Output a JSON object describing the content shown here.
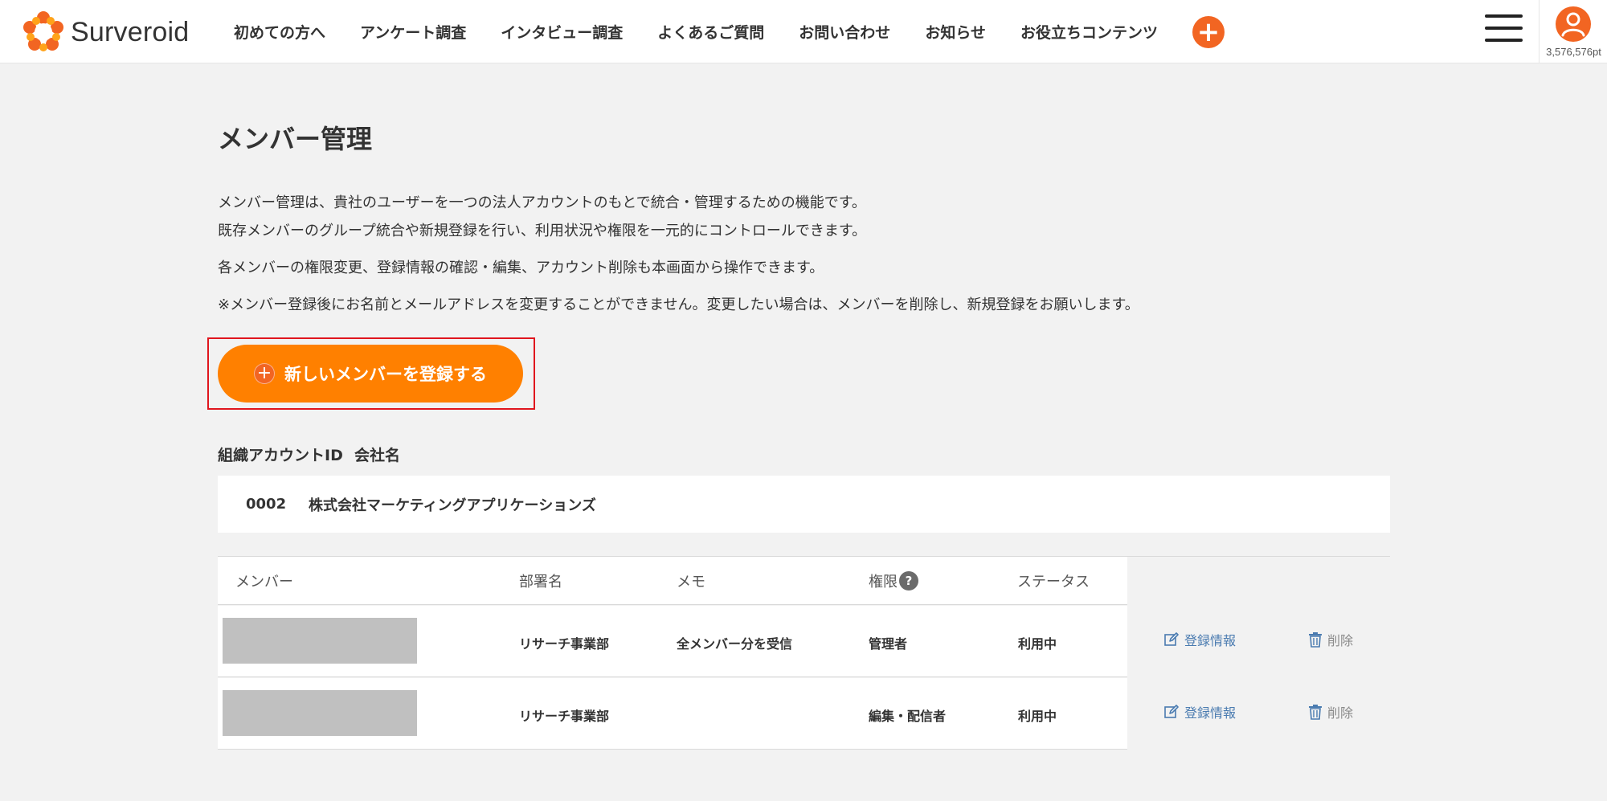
{
  "header": {
    "logo_text": "Surveroid",
    "nav": [
      "初めての方へ",
      "アンケート調査",
      "インタビュー調査",
      "よくあるご質問",
      "お問い合わせ",
      "お知らせ",
      "お役立ちコンテンツ"
    ],
    "plus_symbol": "+",
    "points": "3,576,576pt"
  },
  "page": {
    "title": "メンバー管理",
    "desc1": "メンバー管理は、貴社のユーザーを一つの法人アカウントのもとで統合・管理するための機能です。",
    "desc2": "既存メンバーのグループ統合や新規登録を行い、利用状況や権限を一元的にコントロールできます。",
    "desc3": "各メンバーの権限変更、登録情報の確認・編集、アカウント削除も本画面から操作できます。",
    "desc4": "※メンバー登録後にお名前とメールアドレスを変更することができません。変更したい場合は、メンバーを削除し、新規登録をお願いします。",
    "register_button": "新しいメンバーを登録する",
    "register_plus": "+"
  },
  "org": {
    "id_label": "組織アカウントID",
    "name_label": "会社名",
    "id": "0002",
    "name": "株式会社マーケティングアプリケーションズ"
  },
  "table": {
    "headers": {
      "member": "メンバー",
      "dept": "部署名",
      "memo": "メモ",
      "role": "権限",
      "status": "ステータス",
      "help": "?"
    },
    "rows": [
      {
        "dept": "リサーチ事業部",
        "memo": "全メンバー分を受信",
        "role": "管理者",
        "status": "利用中",
        "edit": "登録情報",
        "delete": "削除"
      },
      {
        "dept": "リサーチ事業部",
        "memo": "",
        "role": "編集・配信者",
        "status": "利用中",
        "edit": "登録情報",
        "delete": "削除"
      }
    ]
  },
  "colors": {
    "brand_orange": "#ff8000",
    "accent_orange": "#f26522",
    "highlight_red": "#e0161e",
    "link_blue": "#4a7bb0"
  }
}
